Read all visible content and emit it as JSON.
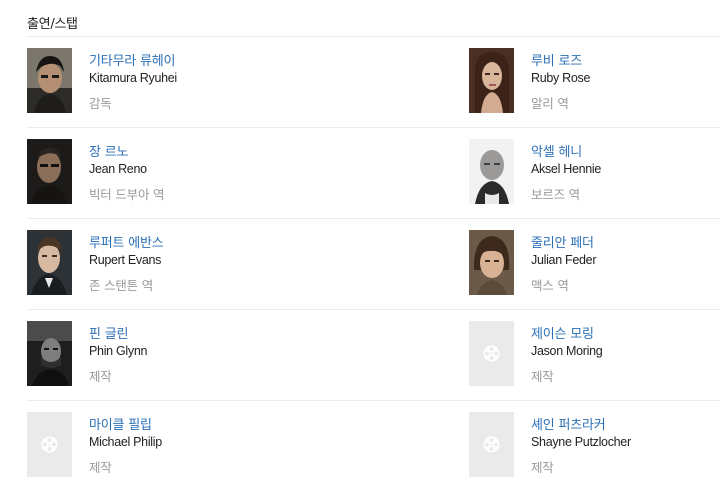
{
  "section": {
    "title": "출연/스탭"
  },
  "cast": [
    {
      "left": {
        "korean_name": "기타무라 류헤이",
        "english_name": "Kitamura Ryuhei",
        "role": "감독",
        "photo": "portrait-photo"
      },
      "right": {
        "korean_name": "루비 로즈",
        "english_name": "Ruby Rose",
        "role": "알리 역",
        "photo": "portrait-photo"
      }
    },
    {
      "left": {
        "korean_name": "장 르노",
        "english_name": "Jean Reno",
        "role": "빅터 드부아 역",
        "photo": "portrait-photo"
      },
      "right": {
        "korean_name": "악셀 헤니",
        "english_name": "Aksel Hennie",
        "role": "보르즈 역",
        "photo": "portrait-photo"
      }
    },
    {
      "left": {
        "korean_name": "루퍼트 에반스",
        "english_name": "Rupert Evans",
        "role": "존 스탠튼 역",
        "photo": "portrait-photo"
      },
      "right": {
        "korean_name": "줄리안 페더",
        "english_name": "Julian Feder",
        "role": "맥스 역",
        "photo": "portrait-photo"
      }
    },
    {
      "left": {
        "korean_name": "핀 글린",
        "english_name": "Phin Glynn",
        "role": "제작",
        "photo": "portrait-photo"
      },
      "right": {
        "korean_name": "제이슨 모링",
        "english_name": "Jason Moring",
        "role": "제작",
        "photo": "film-reel-placeholder-icon"
      }
    },
    {
      "left": {
        "korean_name": "마이클 필립",
        "english_name": "Michael Philip",
        "role": "제작",
        "photo": "film-reel-placeholder-icon"
      },
      "right": {
        "korean_name": "셰인 퍼츠라커",
        "english_name": "Shayne Putzlocher",
        "role": "제작",
        "photo": "film-reel-placeholder-icon"
      }
    }
  ],
  "colors": {
    "name_link": "#2b6fb6",
    "english_name": "#222222",
    "role": "#9a9a9a",
    "divider": "#ececec",
    "placeholder_bg": "#eaeaea"
  }
}
